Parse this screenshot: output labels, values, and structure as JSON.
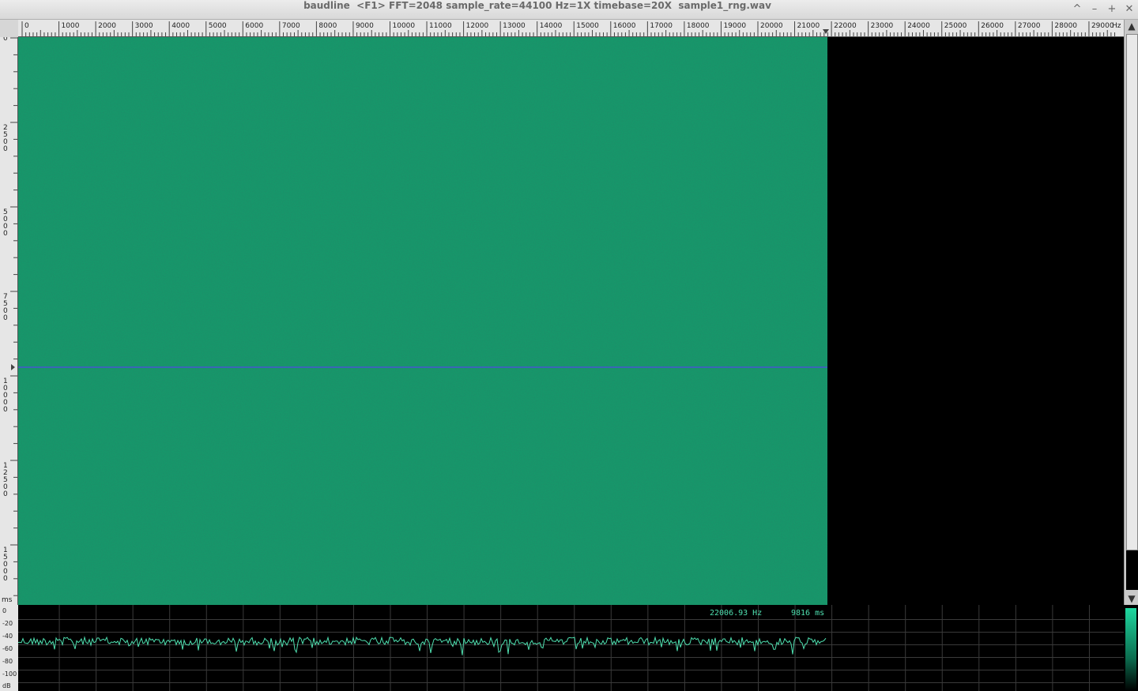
{
  "window": {
    "title": "baudline  <F1> FFT=2048 sample_rate=44100 Hz=1X timebase=20X  sample1_rng.wav",
    "buttons": [
      "^",
      "–",
      "+",
      "✕"
    ]
  },
  "freq_axis": {
    "ticks": [
      "0",
      "1000",
      "2000",
      "3000",
      "4000",
      "5000",
      "6000",
      "7000",
      "8000",
      "9000",
      "10000",
      "11000",
      "12000",
      "13000",
      "14000",
      "15000",
      "16000",
      "17000",
      "18000",
      "19000",
      "20000",
      "21000",
      "22000",
      "23000",
      "24000",
      "25000",
      "26000",
      "27000",
      "28000",
      "29000"
    ],
    "unit": "Hz"
  },
  "time_axis": {
    "ticks": [
      "0",
      "2500",
      "5000",
      "7500",
      "10000",
      "12500",
      "15000"
    ],
    "unit": "ms"
  },
  "db_axis": {
    "ticks": [
      "0",
      "-20",
      "-40",
      "-60",
      "-80",
      "-100"
    ],
    "unit": "dB"
  },
  "readout": {
    "frequency": "22006.93 Hz",
    "time": "9816 ms"
  },
  "colors": {
    "spectrogram": "#16986a",
    "cursor_line": "#3f5fc0",
    "trace": "#4fe0b0",
    "background": "#000000"
  }
}
